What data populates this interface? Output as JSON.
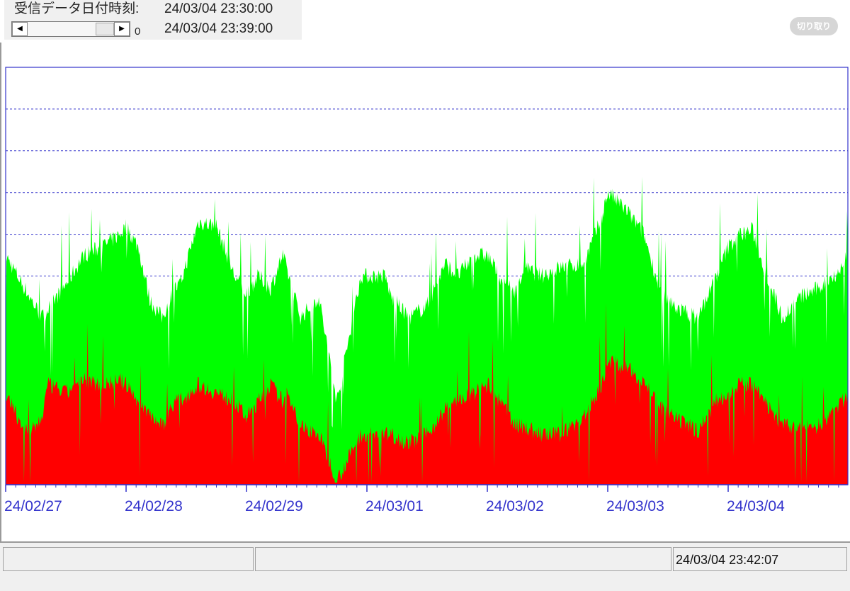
{
  "header": {
    "received_label": "受信データ日付時刻:",
    "received_time_1": "24/03/04 23:30:00",
    "received_time_2": "24/03/04 23:39:00",
    "scroll_value": "0",
    "cut_button": "切り取り"
  },
  "scrollbar": {
    "left_arrow": "◀",
    "right_arrow": "▶"
  },
  "status": {
    "clock": "24/03/04 23:42:07"
  },
  "colors": {
    "green": "#00ff00",
    "red": "#ff0000",
    "axis": "#3333cc",
    "grid": "#3333cc"
  },
  "chart_data": {
    "type": "area",
    "stacked": false,
    "ylim": [
      0,
      100
    ],
    "grid": "horizontal dashed",
    "x_tick_labels": [
      "24/02/27",
      "24/02/28",
      "24/02/29",
      "24/03/01",
      "24/03/02",
      "24/03/03",
      "24/03/04"
    ],
    "series": [
      {
        "color": "#00ff00",
        "x": [
          0,
          0.1,
          0.2,
          0.3,
          0.35,
          0.5,
          0.65,
          0.8,
          0.95,
          1.0,
          1.1,
          1.2,
          1.3,
          1.4,
          1.45,
          1.6,
          1.75,
          1.9,
          2.0,
          2.1,
          2.2,
          2.3,
          2.35,
          2.45,
          2.6,
          2.75,
          2.95,
          3.0,
          3.15,
          3.2,
          3.35,
          3.5,
          3.65,
          3.75,
          3.9,
          4.0,
          4.1,
          4.25,
          4.3,
          4.45,
          4.6,
          4.8,
          4.95,
          5.0,
          5.15,
          5.2,
          5.3,
          5.45,
          5.6,
          5.75,
          5.9,
          6.0,
          6.1,
          6.2,
          6.3,
          6.45,
          6.6,
          6.75,
          6.95,
          7.0
        ],
        "values": [
          55,
          50,
          45,
          40,
          42,
          48,
          55,
          57,
          60,
          62,
          57,
          44,
          40,
          47,
          48,
          63,
          62,
          50,
          46,
          50,
          47,
          55,
          50,
          40,
          45,
          20,
          50,
          50,
          50,
          45,
          40,
          43,
          53,
          50,
          55,
          55,
          50,
          46,
          52,
          50,
          52,
          53,
          64,
          70,
          66,
          64,
          60,
          45,
          42,
          40,
          50,
          57,
          60,
          61,
          52,
          40,
          45,
          47,
          52,
          57
        ]
      },
      {
        "color": "#ff0000",
        "x": [
          0,
          0.1,
          0.2,
          0.3,
          0.35,
          0.5,
          0.65,
          0.8,
          0.95,
          1.0,
          1.1,
          1.2,
          1.3,
          1.4,
          1.45,
          1.6,
          1.75,
          1.9,
          2.0,
          2.1,
          2.2,
          2.3,
          2.35,
          2.45,
          2.6,
          2.75,
          2.95,
          3.0,
          3.15,
          3.2,
          3.35,
          3.5,
          3.65,
          3.75,
          3.9,
          4.0,
          4.1,
          4.25,
          4.3,
          4.45,
          4.6,
          4.8,
          4.95,
          5.0,
          5.15,
          5.2,
          5.3,
          5.45,
          5.6,
          5.75,
          5.9,
          6.0,
          6.1,
          6.2,
          6.3,
          6.45,
          6.6,
          6.75,
          6.95,
          7.0
        ],
        "values": [
          22,
          16,
          12,
          16,
          24,
          22,
          25,
          24,
          25,
          24,
          20,
          17,
          14,
          20,
          20,
          24,
          22,
          20,
          16,
          20,
          24,
          20,
          22,
          14,
          12,
          1,
          12,
          12,
          12,
          12,
          10,
          12,
          18,
          20,
          22,
          24,
          20,
          14,
          14,
          12,
          12,
          16,
          24,
          30,
          28,
          27,
          25,
          18,
          15,
          13,
          20,
          22,
          24,
          24,
          20,
          14,
          14,
          14,
          20,
          22
        ]
      }
    ]
  }
}
